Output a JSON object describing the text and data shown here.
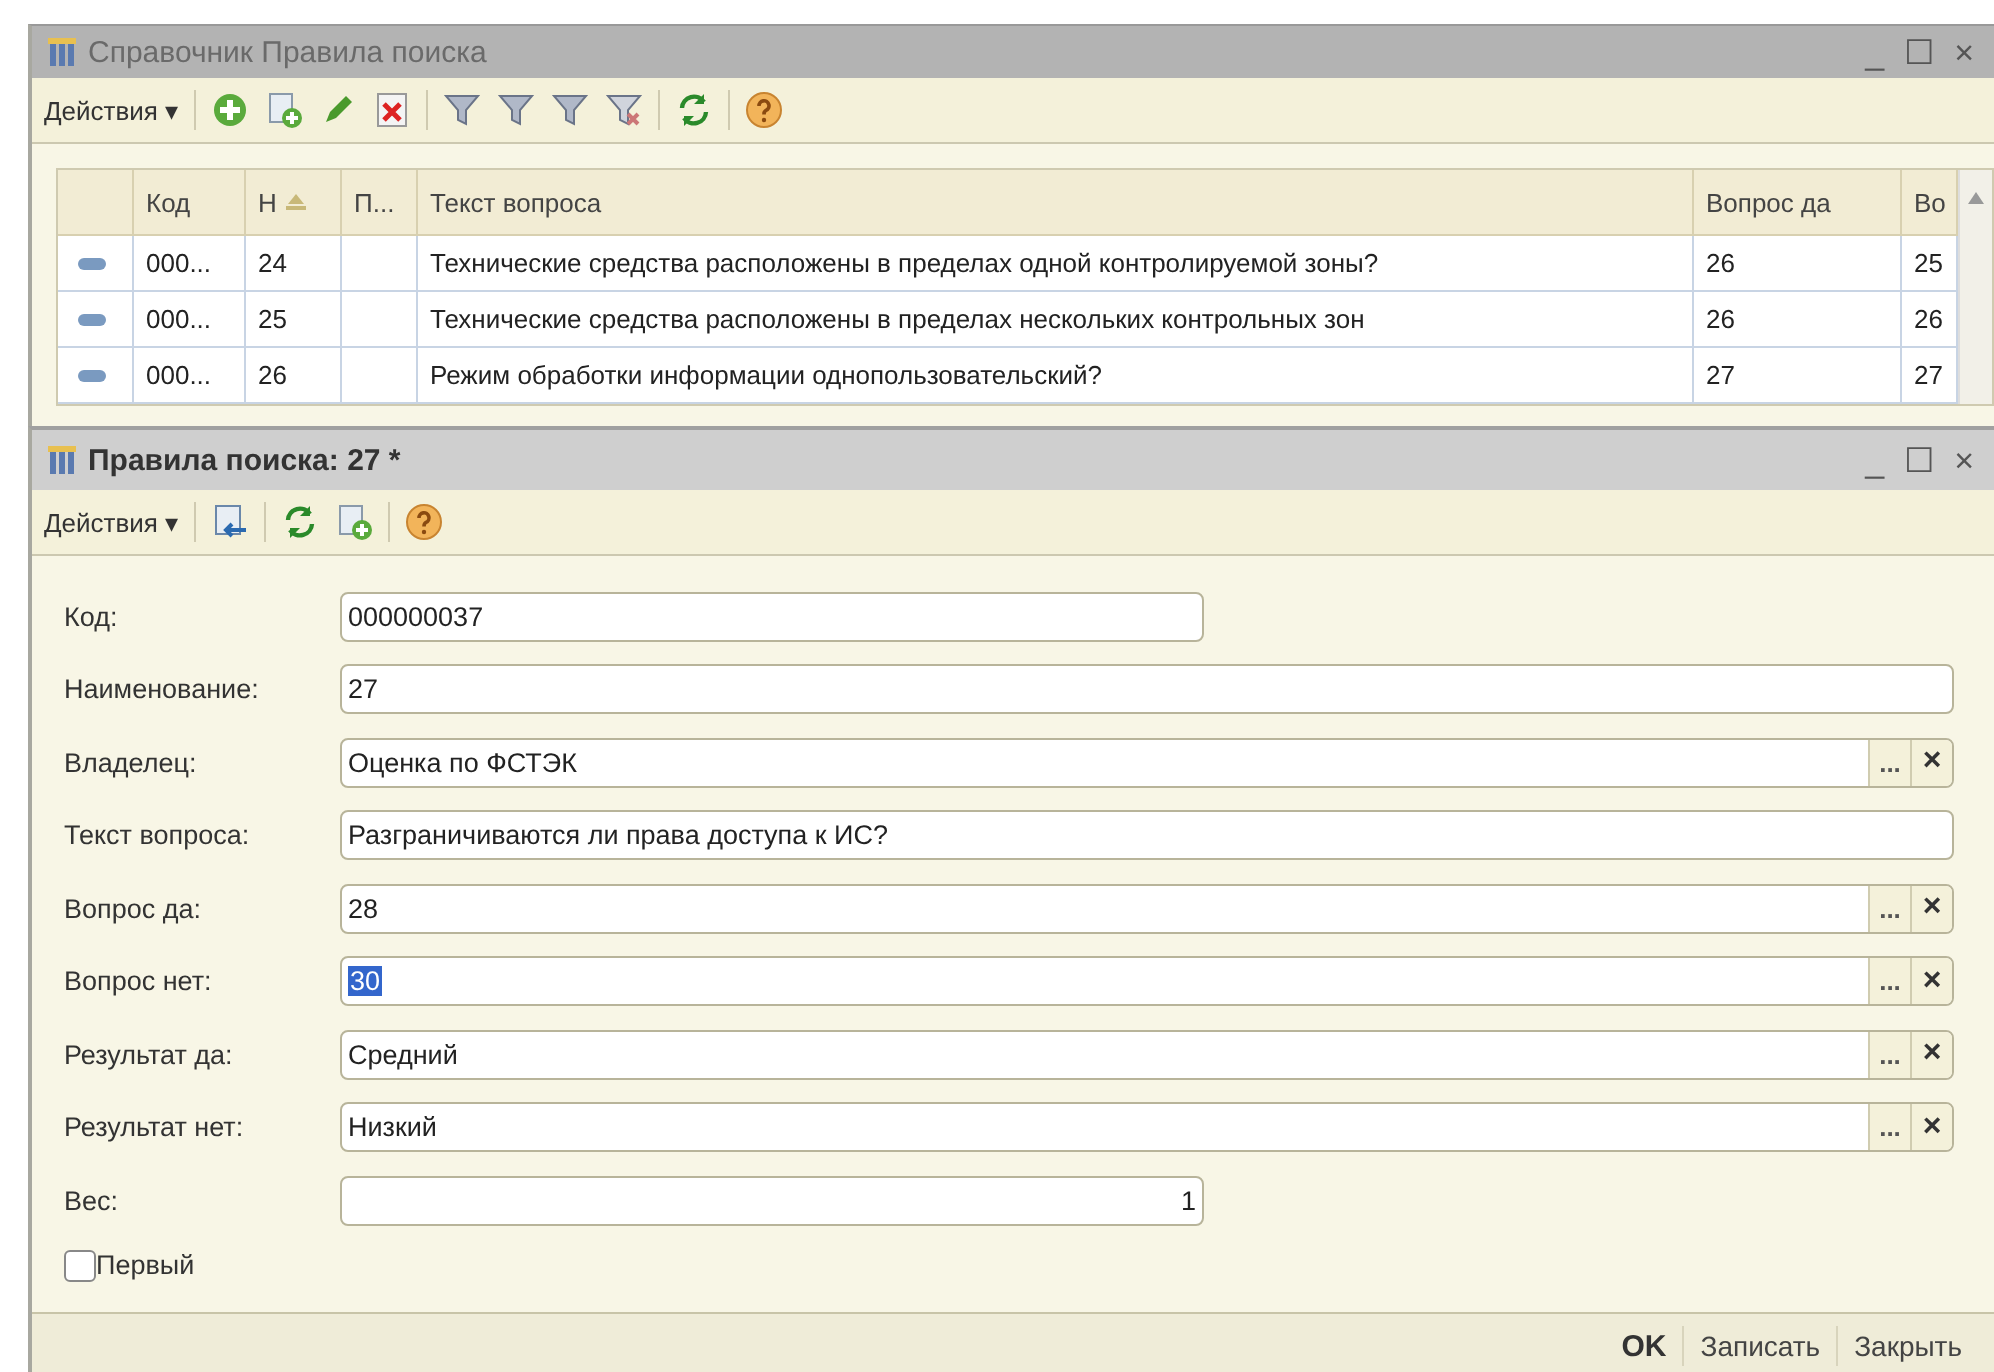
{
  "back_window": {
    "title": "Справочник Правила поиска",
    "controls": [
      "_",
      "☐",
      "×"
    ],
    "toolbar": {
      "actions_label": "Действия ▾"
    },
    "table": {
      "columns": [
        "Код",
        "Н",
        "П...",
        "Текст вопроса",
        "Вопрос да",
        "Во"
      ],
      "rows": [
        {
          "cells": [
            "000...",
            "24",
            "",
            "Технические средства расположены в пределах одной контролируемой зоны?",
            "26",
            "25"
          ]
        },
        {
          "cells": [
            "000...",
            "25",
            "",
            "Технические средства расположены в пределах нескольких контрольных зон",
            "26",
            "26"
          ]
        },
        {
          "cells": [
            "000...",
            "26",
            "",
            "Режим обработки информации однопользовательский?",
            "27",
            "27"
          ]
        }
      ]
    }
  },
  "form_window": {
    "title": "Правила поиска: 27 *",
    "controls": [
      "_",
      "☐",
      "×"
    ],
    "toolbar": {
      "actions_label": "Действия ▾"
    },
    "fields": [
      {
        "kind": "short",
        "label": "Код:",
        "value": "000000037",
        "highlighted": false
      },
      {
        "kind": "full",
        "label": "Наименование:",
        "value": "27",
        "highlighted": false
      },
      {
        "kind": "ref",
        "label": "Владелец:",
        "value": "Оценка по ФСТЭК",
        "highlighted": false
      },
      {
        "kind": "full",
        "label": "Текст вопроса:",
        "value": "Разграничиваются ли права доступа к ИС?",
        "highlighted": false
      },
      {
        "kind": "ref",
        "label": "Вопрос да:",
        "value": "28",
        "highlighted": false
      },
      {
        "kind": "ref",
        "label": "Вопрос нет:",
        "value": "30",
        "highlighted": true
      },
      {
        "kind": "ref",
        "label": "Результат да:",
        "value": "Средний",
        "highlighted": false
      },
      {
        "kind": "ref",
        "label": "Результат нет:",
        "value": "Низкий",
        "highlighted": false
      },
      {
        "kind": "number",
        "label": "Вес:",
        "value": "1",
        "highlighted": false
      }
    ],
    "ref_buttons": [
      "...",
      "×"
    ],
    "checkbox": {
      "label": "Первый",
      "checked": false
    },
    "buttons": [
      {
        "label": "OK",
        "kind": "default"
      },
      {
        "label": "Записать",
        "kind": "plain"
      },
      {
        "label": "Закрыть",
        "kind": "plain"
      }
    ]
  }
}
